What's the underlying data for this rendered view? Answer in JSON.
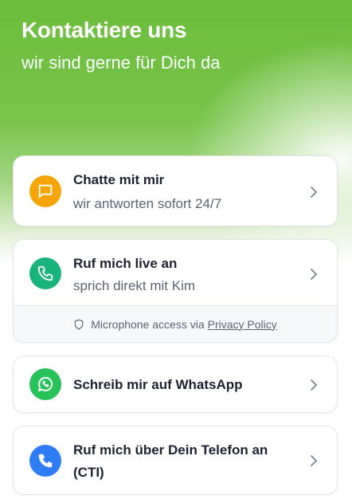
{
  "header": {
    "title": "Kontaktiere uns",
    "subtitle": "wir sind gerne für Dich da"
  },
  "options": {
    "chat": {
      "label": "Chatte mit mir",
      "sub": "wir antworten sofort 24/7",
      "icon": "chat-bubble-icon",
      "color": "#f5a508"
    },
    "call": {
      "label": "Ruf mich live an",
      "sub": "sprich direkt mit Kim",
      "icon": "phone-icon",
      "color": "#19b37e"
    },
    "privacy": {
      "text": "Microphone access via",
      "link": "Privacy Policy",
      "icon": "shield-icon"
    },
    "whatsapp": {
      "label": "Schreib mir auf WhatsApp",
      "icon": "whatsapp-icon",
      "color": "#27c25a"
    },
    "cti": {
      "label_line1": "Ruf mich über Dein Telefon an",
      "label_line2": "(CTI)",
      "icon": "phone-icon",
      "color": "#2f7cf6"
    }
  }
}
